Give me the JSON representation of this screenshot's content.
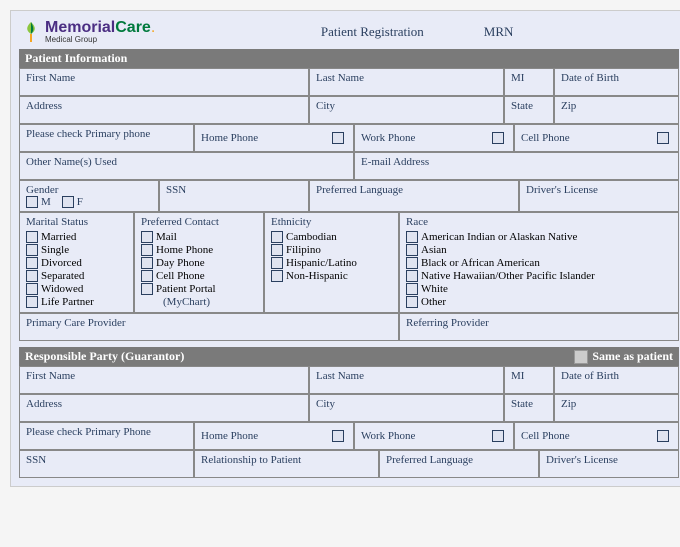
{
  "logo": {
    "prefix": "Memorial",
    "suffix": "Care",
    "dot": ".",
    "sub": "Medical Group"
  },
  "header": {
    "title": "Patient Registration",
    "mrn": "MRN"
  },
  "section1": {
    "title": "Patient Information"
  },
  "pi": {
    "first_name": "First Name",
    "last_name": "Last Name",
    "mi": "MI",
    "dob": "Date of Birth",
    "address": "Address",
    "city": "City",
    "state": "State",
    "zip": "Zip",
    "check_primary": "Please check Primary phone",
    "home_phone": "Home Phone",
    "work_phone": "Work Phone",
    "cell_phone": "Cell Phone",
    "other_names": "Other Name(s) Used",
    "email": "E-mail Address",
    "gender": "Gender",
    "m": "M",
    "f": "F",
    "ssn": "SSN",
    "pref_lang": "Preferred Language",
    "license": "Driver's License"
  },
  "marital": {
    "title": "Marital Status",
    "opts": [
      "Married",
      "Single",
      "Divorced",
      "Separated",
      "Widowed",
      "Life Partner"
    ]
  },
  "contact": {
    "title": "Preferred Contact",
    "opts": [
      "Mail",
      "Home Phone",
      "Day Phone",
      "Cell Phone",
      "Patient Portal"
    ],
    "sub": "(MyChart)"
  },
  "ethnicity": {
    "title": "Ethnicity",
    "opts": [
      "Cambodian",
      "Filipino",
      "Hispanic/Latino",
      "Non-Hispanic"
    ]
  },
  "race": {
    "title": "Race",
    "opts": [
      "American Indian or Alaskan Native",
      "Asian",
      "Black or African American",
      "Native Hawaiian/Other Pacific Islander",
      "White",
      "Other"
    ]
  },
  "providers": {
    "pcp": "Primary Care Provider",
    "ref": "Referring Provider"
  },
  "section2": {
    "title": "Responsible Party (Guarantor)",
    "same": "Same as patient"
  },
  "rp": {
    "first_name": "First Name",
    "last_name": "Last Name",
    "mi": "MI",
    "dob": "Date of Birth",
    "address": "Address",
    "city": "City",
    "state": "State",
    "zip": "Zip",
    "check_primary": "Please check Primary Phone",
    "home_phone": "Home Phone",
    "work_phone": "Work Phone",
    "cell_phone": "Cell Phone",
    "ssn": "SSN",
    "relationship": "Relationship to Patient",
    "pref_lang": "Preferred Language",
    "license": "Driver's License"
  }
}
